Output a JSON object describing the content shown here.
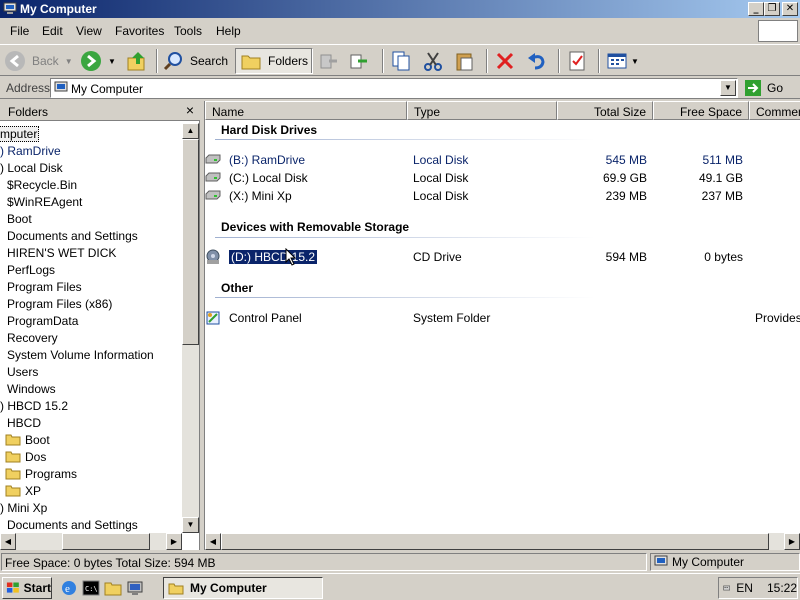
{
  "window": {
    "title": "My Computer"
  },
  "menu": {
    "items": [
      "File",
      "Edit",
      "View",
      "Favorites",
      "Tools",
      "Help"
    ]
  },
  "toolbar": {
    "back_label": "Back",
    "search_label": "Search",
    "folders_label": "Folders"
  },
  "address": {
    "label": "Address",
    "value": "My Computer",
    "go_label": "Go"
  },
  "folders_pane": {
    "title": "Folders",
    "close_glyph": "×",
    "items": [
      {
        "label": "mputer"
      },
      {
        "label": ") RamDrive"
      },
      {
        "label": ") Local Disk"
      },
      {
        "label": "$Recycle.Bin"
      },
      {
        "label": "$WinREAgent"
      },
      {
        "label": "Boot"
      },
      {
        "label": "Documents and Settings"
      },
      {
        "label": "HIREN'S WET DICK"
      },
      {
        "label": "PerfLogs"
      },
      {
        "label": "Program Files"
      },
      {
        "label": "Program Files (x86)"
      },
      {
        "label": "ProgramData"
      },
      {
        "label": "Recovery"
      },
      {
        "label": "System Volume Information"
      },
      {
        "label": "Users"
      },
      {
        "label": "Windows"
      },
      {
        "label": ") HBCD 15.2"
      },
      {
        "label": "HBCD"
      },
      {
        "label": "Boot"
      },
      {
        "label": "Dos"
      },
      {
        "label": "Programs"
      },
      {
        "label": "XP"
      },
      {
        "label": ") Mini Xp"
      },
      {
        "label": "Documents and Settings"
      }
    ]
  },
  "columns": {
    "name": "Name",
    "type": "Type",
    "total_size": "Total Size",
    "free_space": "Free Space",
    "comments": "Comment"
  },
  "groups": [
    {
      "title": "Hard Disk Drives"
    },
    {
      "title": "Devices with Removable Storage"
    },
    {
      "title": "Other"
    }
  ],
  "rows": [
    {
      "name": "(B:) RamDrive",
      "type": "Local Disk",
      "total": "545 MB",
      "free": "511 MB",
      "comment": ""
    },
    {
      "name": "(C:) Local Disk",
      "type": "Local Disk",
      "total": "69.9 GB",
      "free": "49.1 GB",
      "comment": ""
    },
    {
      "name": "(X:) Mini Xp",
      "type": "Local Disk",
      "total": "239 MB",
      "free": "237 MB",
      "comment": ""
    },
    {
      "name": "(D:) HBCD 15.2",
      "type": "CD Drive",
      "total": "594 MB",
      "free": "0 bytes",
      "comment": ""
    },
    {
      "name": "Control Panel",
      "type": "System Folder",
      "total": "",
      "free": "",
      "comment": "Provides"
    }
  ],
  "status": {
    "left": "Free Space: 0 bytes Total Size: 594 MB",
    "right": "My Computer"
  },
  "taskbar": {
    "start_label": "Start",
    "task_label": "My Computer",
    "lang": "EN",
    "clock": "15:22"
  },
  "colors": {
    "title_start": "#0a246a",
    "title_end": "#a6caf0",
    "selection": "#0a246a",
    "face": "#d4d0c8"
  }
}
